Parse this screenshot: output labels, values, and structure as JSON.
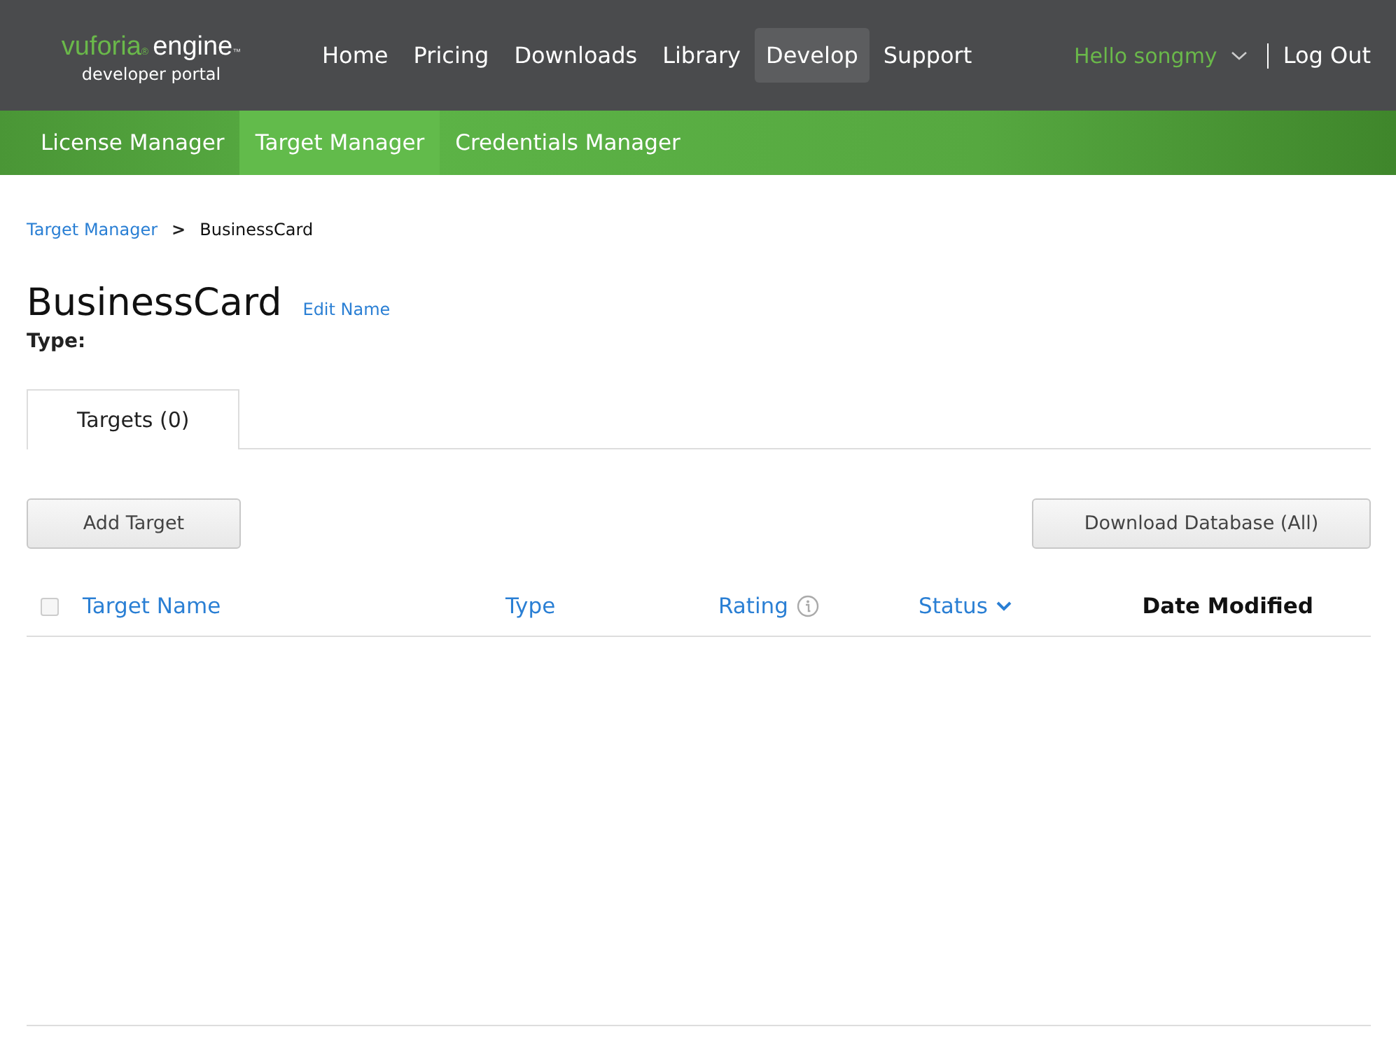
{
  "header": {
    "logo": {
      "brand": "vuforia",
      "brand_mark": "®",
      "product": "engine",
      "product_mark": "™",
      "subtitle": "developer portal"
    },
    "nav": [
      {
        "label": "Home",
        "selected": false
      },
      {
        "label": "Pricing",
        "selected": false
      },
      {
        "label": "Downloads",
        "selected": false
      },
      {
        "label": "Library",
        "selected": false
      },
      {
        "label": "Develop",
        "selected": true
      },
      {
        "label": "Support",
        "selected": false
      }
    ],
    "user": "Hello songmy",
    "logout": "Log Out"
  },
  "subnav": [
    {
      "label": "License Manager",
      "selected": false
    },
    {
      "label": "Target Manager",
      "selected": true
    },
    {
      "label": "Credentials Manager",
      "selected": false
    }
  ],
  "breadcrumb": {
    "link": "Target Manager",
    "separator": ">",
    "current": "BusinessCard"
  },
  "title": "BusinessCard",
  "edit_link": "Edit Name",
  "type_label": "Type:",
  "tabs": [
    {
      "label": "Targets (0)",
      "selected": true
    }
  ],
  "buttons": {
    "add": "Add Target",
    "download": "Download Database (All)"
  },
  "table": {
    "select_all_checked": false,
    "columns": [
      {
        "label": "Target Name",
        "kind": "link"
      },
      {
        "label": "Type",
        "kind": "link"
      },
      {
        "label": "Rating",
        "kind": "info"
      },
      {
        "label": "Status",
        "kind": "sort"
      },
      {
        "label": "Date Modified",
        "kind": "plain"
      }
    ]
  }
}
